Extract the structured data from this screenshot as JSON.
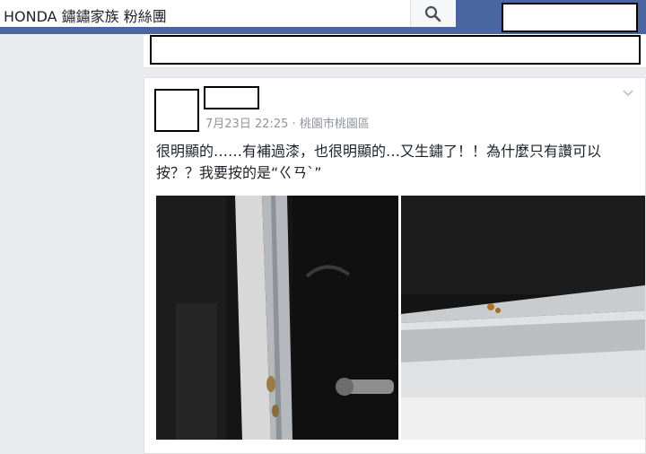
{
  "search": {
    "query": "HONDA 鏽鏽家族 粉絲團"
  },
  "icons": {
    "search": "search-icon",
    "chevron": "chevron-down-icon"
  },
  "colors": {
    "topbar": "#4a66a0",
    "page_background": "#e9ebee",
    "meta_text": "#90949c"
  },
  "post": {
    "date": "7月23日 22:25",
    "separator": "·",
    "location": "桃園市桃園區",
    "text": "很明顯的……有補過漆，也很明顯的…又生鏽了！！為什麼只有讚可以按？？我要按的是“ㄍㄢˋ”",
    "photos": [
      {
        "subject": "rusted door frame edge, close-up"
      },
      {
        "subject": "rust spot on white door frame trim"
      }
    ]
  }
}
